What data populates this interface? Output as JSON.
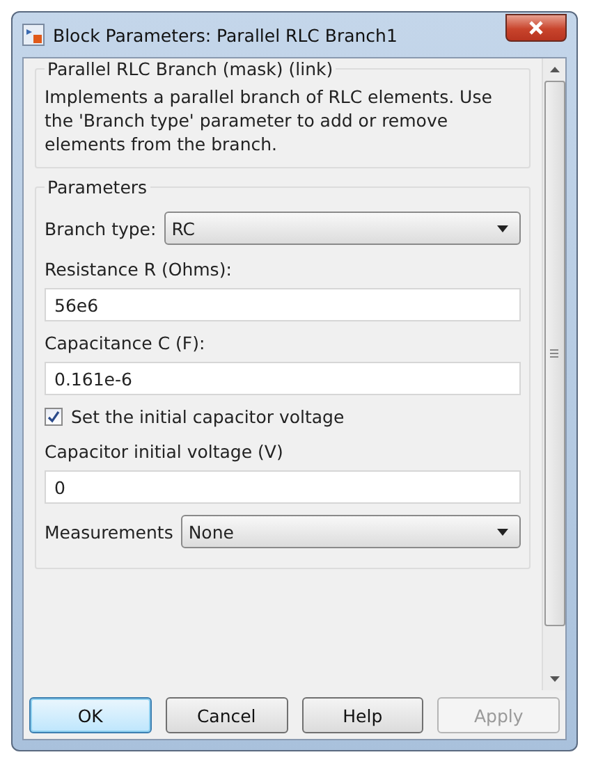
{
  "window": {
    "title": "Block Parameters: Parallel RLC Branch1"
  },
  "mask": {
    "title": "Parallel RLC Branch (mask) (link)",
    "description": "Implements a parallel branch of RLC elements. Use the 'Branch type' parameter to add or remove elements from the branch."
  },
  "parameters": {
    "title": "Parameters",
    "items": [
      {
        "kind": "dropdown",
        "label": "Branch type:",
        "value": "RC"
      },
      {
        "kind": "field",
        "label": "Resistance R (Ohms):",
        "value": "56e6"
      },
      {
        "kind": "field",
        "label": "Capacitance C (F):",
        "value": "0.161e-6"
      },
      {
        "kind": "checkbox",
        "label": "Set the initial capacitor voltage",
        "checked": true
      },
      {
        "kind": "field",
        "label": "Capacitor initial voltage (V)",
        "value": "0"
      },
      {
        "kind": "dropdown",
        "label": "Measurements",
        "value": "None"
      }
    ]
  },
  "buttons": [
    {
      "label": "OK",
      "default": true,
      "disabled": false
    },
    {
      "label": "Cancel",
      "default": false,
      "disabled": false
    },
    {
      "label": "Help",
      "default": false,
      "disabled": false
    },
    {
      "label": "Apply",
      "default": false,
      "disabled": true
    }
  ]
}
